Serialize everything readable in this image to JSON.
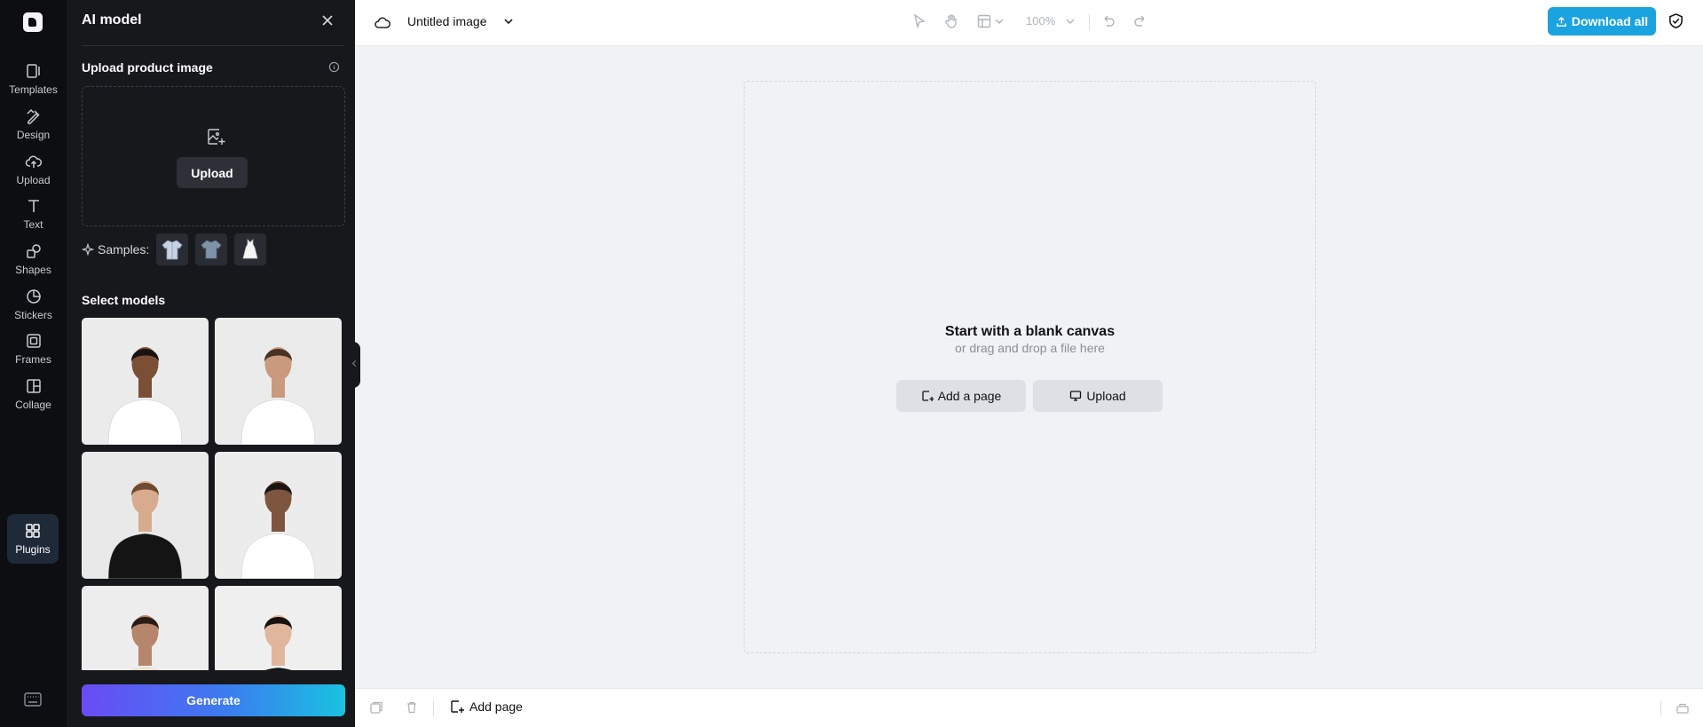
{
  "rail": {
    "items": [
      {
        "label": "Templates",
        "icon": "templates-icon"
      },
      {
        "label": "Design",
        "icon": "design-icon"
      },
      {
        "label": "Upload",
        "icon": "upload-cloud-icon"
      },
      {
        "label": "Text",
        "icon": "text-icon"
      },
      {
        "label": "Shapes",
        "icon": "shapes-icon"
      },
      {
        "label": "Stickers",
        "icon": "stickers-icon"
      },
      {
        "label": "Frames",
        "icon": "frames-icon"
      },
      {
        "label": "Collage",
        "icon": "collage-icon"
      },
      {
        "label": "Plugins",
        "icon": "plugins-icon",
        "active": true
      }
    ]
  },
  "panel": {
    "title": "AI model",
    "upload_section": "Upload product image",
    "upload_button": "Upload",
    "samples_label": "Samples:",
    "samples": [
      "shirt-sample",
      "tshirt-sample",
      "dress-sample"
    ],
    "models_section": "Select models",
    "models": [
      {
        "name": "model-1",
        "top": "#ffffff",
        "skin": "#7a4f36",
        "hair": "#1a1210",
        "bg": "#ebebeb"
      },
      {
        "name": "model-2",
        "top": "#ffffff",
        "skin": "#c99a7e",
        "hair": "#4a3224",
        "bg": "#ebebeb"
      },
      {
        "name": "model-3",
        "top": "#141414",
        "skin": "#d8ab8f",
        "hair": "#6d4a30",
        "bg": "#e9e9e9"
      },
      {
        "name": "model-4",
        "top": "#ffffff",
        "skin": "#7e563f",
        "hair": "#1d1511",
        "bg": "#ececec"
      },
      {
        "name": "model-5",
        "top": "#f2e4c5",
        "skin": "#b5866b",
        "hair": "#2a1c15",
        "bg": "#ededed"
      },
      {
        "name": "model-6",
        "top": "#131313",
        "skin": "#e0b79c",
        "hair": "#161210",
        "bg": "#efefef"
      }
    ],
    "generate_button": "Generate"
  },
  "topbar": {
    "title": "Untitled image",
    "zoom": "100%",
    "download_button": "Download all"
  },
  "canvas": {
    "title": "Start with a blank canvas",
    "subtitle": "or drag and drop a file here",
    "add_page_button": "Add a page",
    "upload_button": "Upload"
  },
  "bottombar": {
    "add_page": "Add page"
  },
  "colors": {
    "accent": "#1ba3e0",
    "panel_bg": "#17181c",
    "rail_bg": "#0d0e11",
    "canvas_bg": "#f0f2f5"
  }
}
